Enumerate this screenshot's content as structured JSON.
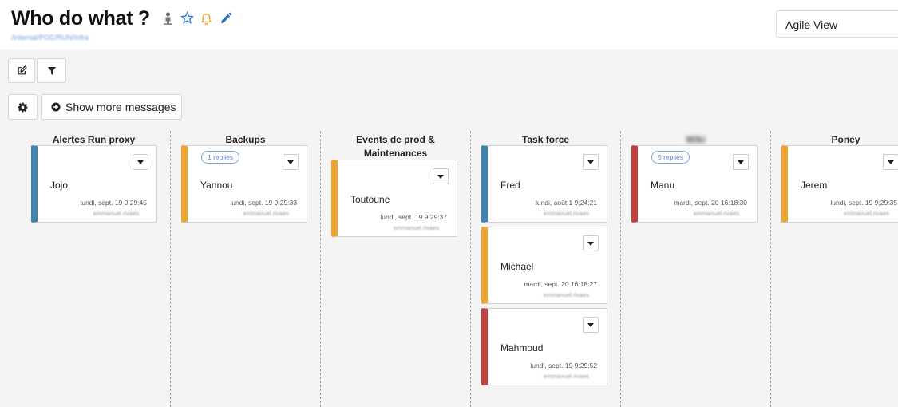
{
  "header": {
    "title": "Who do what ?",
    "breadcrumb": "/Internal/POC/RUN/Infra",
    "view_select": "Agile View",
    "icons": [
      "user-icon",
      "star-icon",
      "bell-icon",
      "pencil-icon"
    ]
  },
  "toolbar": {
    "edit_icon": "edit-icon",
    "filter_icon": "filter-icon",
    "settings_icon": "gear-icon",
    "show_more_label": "Show more messages"
  },
  "columns": [
    {
      "title": "Alertes Run proxy",
      "cards": [
        {
          "color": "#3d85b0",
          "name": "Jojo",
          "date": "lundi, sept. 19 9:29:45",
          "author": "emmanuel.rivaes"
        }
      ]
    },
    {
      "title": "Backups",
      "cards": [
        {
          "color": "#f0a531",
          "replies": "1 replies",
          "name": "Yannou",
          "date": "lundi, sept. 19 9:29:33",
          "author": "emmanuel.rivaes"
        }
      ]
    },
    {
      "title": "Events de prod & Maintenances",
      "cards": [
        {
          "color": "#f0a531",
          "name": "Toutoune",
          "date": "lundi, sept. 19 9:29:37",
          "author": "emmanuel.rivaes"
        }
      ]
    },
    {
      "title": "Task force",
      "cards": [
        {
          "color": "#3d85b0",
          "name": "Fred",
          "date": "lundi, août 1 9:24:21",
          "author": "emmanuel.rivaes"
        },
        {
          "color": "#f0a531",
          "name": "Michael",
          "date": "mardi, sept. 20 16:18:27",
          "author": "emmanuel.rivaes"
        },
        {
          "color": "#c4423e",
          "name": "Mahmoud",
          "date": "lundi, sept. 19 9:29:52",
          "author": "emmanuel.rivaes"
        }
      ]
    },
    {
      "title": "Wiki",
      "cards": [
        {
          "color": "#c4423e",
          "replies": "5 replies",
          "name": "Manu",
          "date": "mardi, sept. 20 16:18:30",
          "author": "emmanuel.rivaes"
        }
      ]
    },
    {
      "title": "Poney",
      "cards": [
        {
          "color": "#f0a531",
          "name": "Jerem",
          "date": "lundi, sept. 19 9:29:35",
          "author": "emmanuel.rivaes"
        }
      ]
    }
  ]
}
